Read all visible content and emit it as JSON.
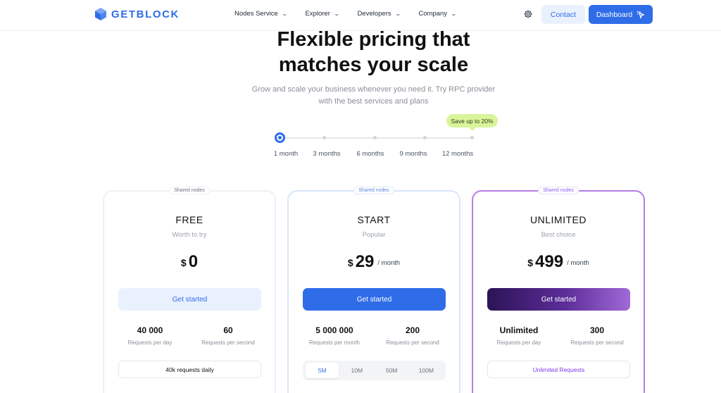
{
  "brand": {
    "name": "GETBLOCK",
    "accent": "#2f6de8"
  },
  "nav": {
    "items": [
      {
        "label": "Nodes Service"
      },
      {
        "label": "Explorer"
      },
      {
        "label": "Developers"
      },
      {
        "label": "Company"
      }
    ],
    "settings_icon": "gear-icon",
    "contact_label": "Contact",
    "dashboard_label": "Dashboard"
  },
  "hero": {
    "title_line1": "Flexible pricing that",
    "title_line2": "matches your scale",
    "subtitle_line1": "Grow and scale your business whenever you need it. Try RPC provider",
    "subtitle_line2": "with the best services and plans"
  },
  "billing": {
    "badge": "Save up to 20%",
    "selected": "1 month",
    "periods": [
      "1 month",
      "3 months",
      "6 months",
      "9 months",
      "12 months"
    ]
  },
  "plans": [
    {
      "tag": "Shared nodes",
      "name": "FREE",
      "desc": "Worth to try",
      "currency": "$",
      "amount": "0",
      "period": "",
      "cta": "Get started",
      "stat1_value": "40 000",
      "stat1_label": "Requests per day",
      "stat2_value": "60",
      "stat2_label": "Requests per second",
      "footer": "40k requests daily"
    },
    {
      "tag": "Shared nodes",
      "name": "START",
      "desc": "Popular",
      "currency": "$",
      "amount": "29",
      "period": "/ month",
      "cta": "Get started",
      "stat1_value": "5 000 000",
      "stat1_label": "Requests per month",
      "stat2_value": "200",
      "stat2_label": "Requests per second",
      "options": [
        "5M",
        "10M",
        "50M",
        "100M"
      ],
      "selected_option": "5M"
    },
    {
      "tag": "Shared nodes",
      "name": "UNLIMITED",
      "desc": "Best choice",
      "currency": "$",
      "amount": "499",
      "period": "/ month",
      "cta": "Get started",
      "stat1_value": "Unlimited",
      "stat1_label": "Requests per day",
      "stat2_value": "300",
      "stat2_label": "Requests per second",
      "footer": "Unlimited Requests"
    }
  ]
}
